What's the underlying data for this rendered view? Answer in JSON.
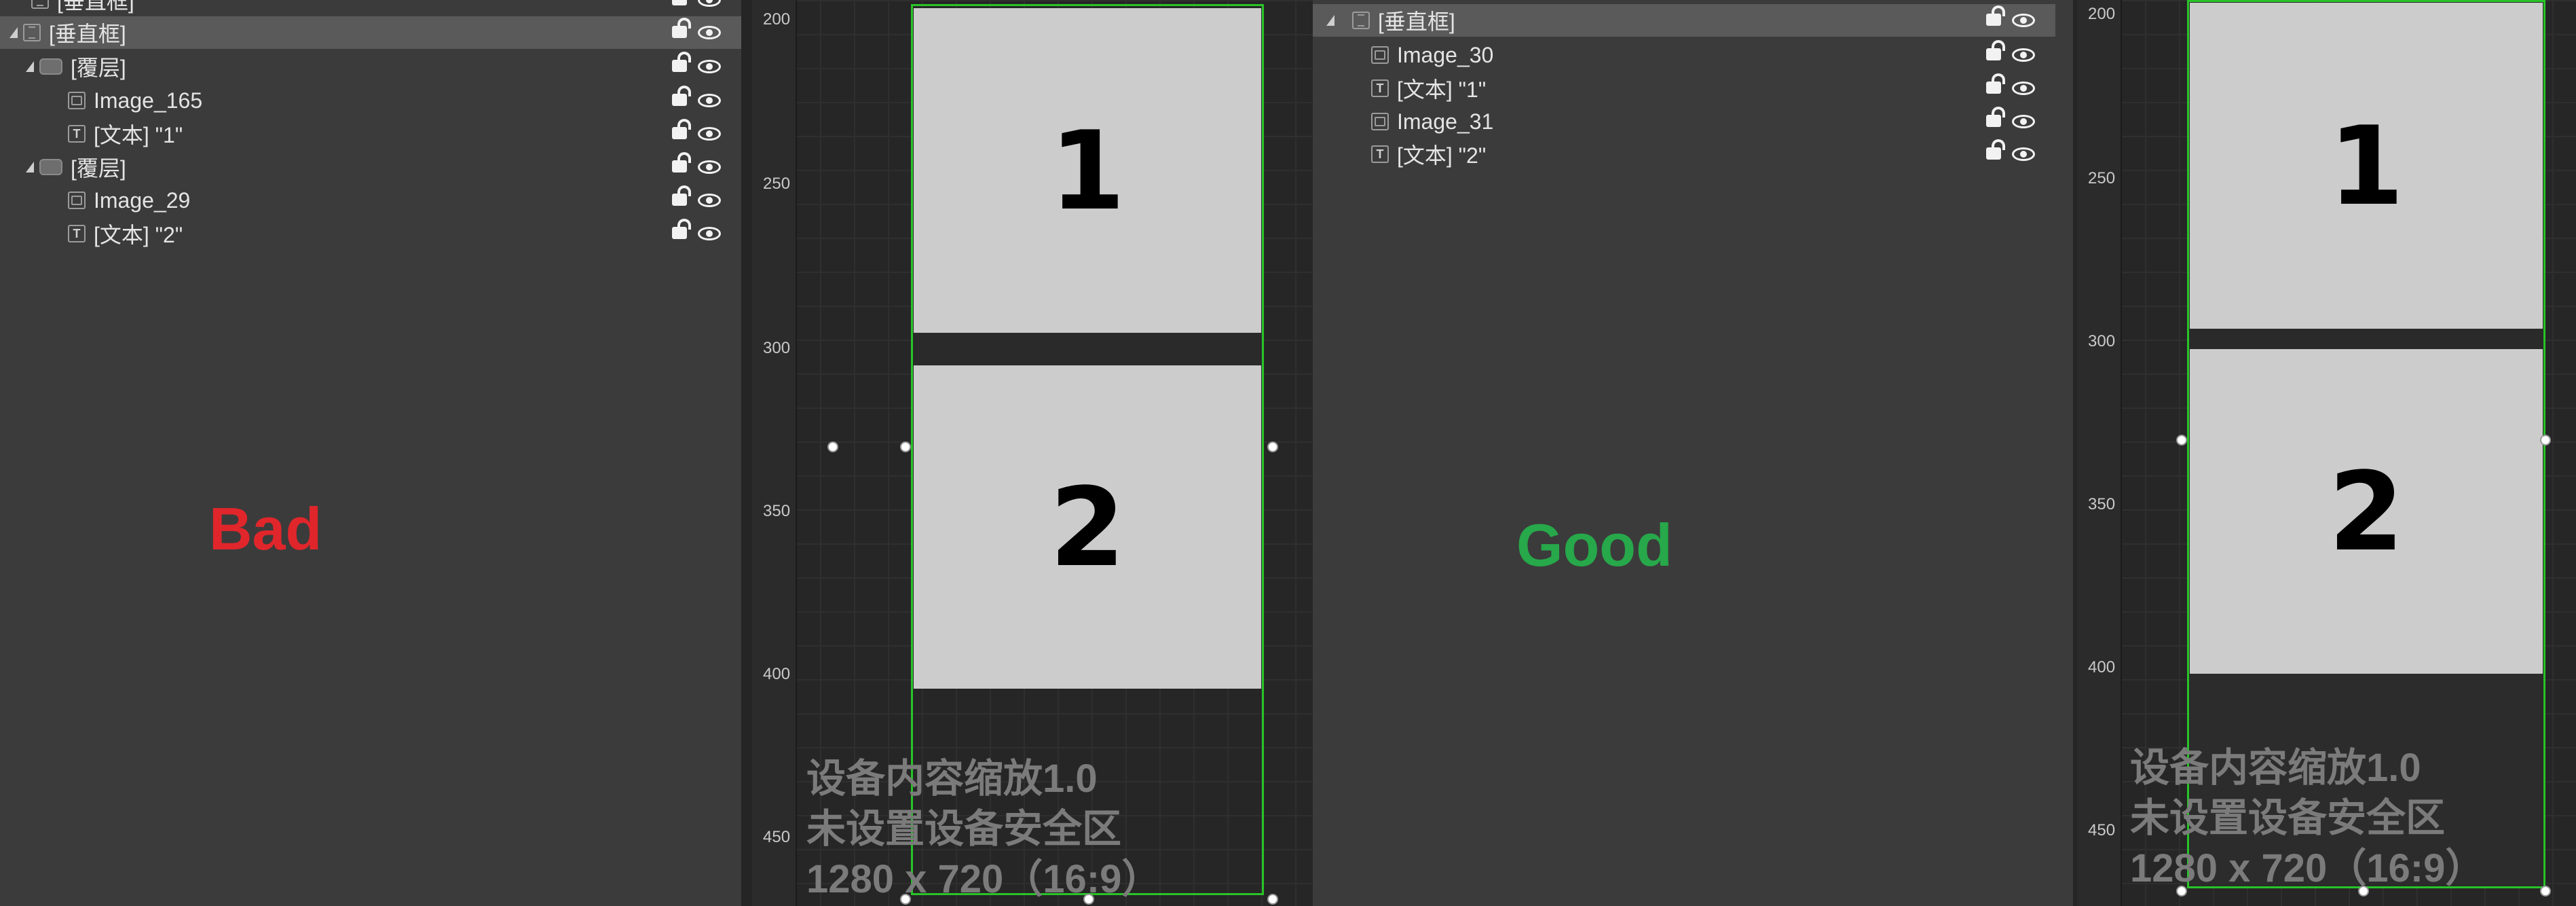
{
  "left_outliner": {
    "rows": [
      {
        "label": "[垂直框]",
        "icon": "vertical-box-icon"
      },
      {
        "label": "[垂直框]",
        "icon": "vertical-box-icon",
        "selected": true
      },
      {
        "label": "[覆层]",
        "icon": "overlay-icon"
      },
      {
        "label": "Image_165",
        "icon": "image-icon"
      },
      {
        "label": "[文本] \"1\"",
        "icon": "text-icon"
      },
      {
        "label": "[覆层]",
        "icon": "overlay-icon"
      },
      {
        "label": "Image_29",
        "icon": "image-icon"
      },
      {
        "label": "[文本] \"2\"",
        "icon": "text-icon"
      }
    ],
    "verdict": "Bad",
    "verdict_color": "#e0262b"
  },
  "right_outliner": {
    "rows": [
      {
        "label": "[垂直框]",
        "icon": "vertical-box-icon",
        "selected": true
      },
      {
        "label": "Image_30",
        "icon": "image-icon"
      },
      {
        "label": "[文本] \"1\"",
        "icon": "text-icon"
      },
      {
        "label": "Image_31",
        "icon": "image-icon"
      },
      {
        "label": "[文本] \"2\"",
        "icon": "text-icon"
      }
    ],
    "verdict": "Good",
    "verdict_color": "#27a84a"
  },
  "icon_letters": {
    "text": "T"
  },
  "left_canvas": {
    "ruler_ticks": [
      "200",
      "250",
      "300",
      "350",
      "400",
      "450"
    ],
    "tile_1": "1",
    "tile_2": "2",
    "overlay_lines": [
      "设备内容缩放1.0",
      "未设置设备安全区",
      "1280 x 720（16:9）"
    ]
  },
  "right_canvas": {
    "ruler_ticks": [
      "200",
      "250",
      "300",
      "350",
      "400",
      "450"
    ],
    "tile_1": "1",
    "tile_2": "2",
    "overlay_lines": [
      "设备内容缩放1.0",
      "未设置设备安全区",
      "1280 x 720（16:9）"
    ]
  },
  "colors": {
    "frame_green": "#28c428",
    "panel_bg": "#3b3b3b",
    "tile_gray": "#cccccc"
  }
}
